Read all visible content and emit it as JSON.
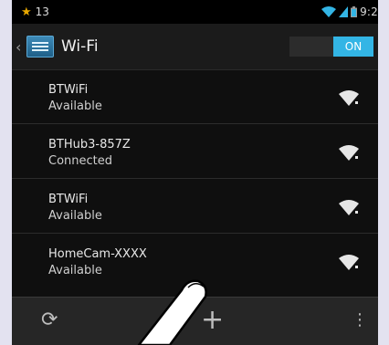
{
  "status_bar": {
    "notification_count": "13",
    "time": "9:2"
  },
  "action_bar": {
    "title": "Wi-Fi",
    "toggle_label": "ON"
  },
  "networks": [
    {
      "ssid": "BTWiFi",
      "status": "Available"
    },
    {
      "ssid": "BTHub3-857Z",
      "status": "Connected"
    },
    {
      "ssid": "BTWiFi",
      "status": "Available"
    },
    {
      "ssid": "HomeCam-XXXX",
      "status": "Available"
    }
  ],
  "icons": {
    "notification": "star-icon",
    "wifi_signal": "wifi-signal-icon",
    "scan": "refresh-icon",
    "add_network": "add-icon",
    "overflow": "more-vert-icon"
  },
  "colors": {
    "accent": "#33b5e5",
    "background": "#0f0f0f",
    "frame": "#e3e2f0"
  }
}
